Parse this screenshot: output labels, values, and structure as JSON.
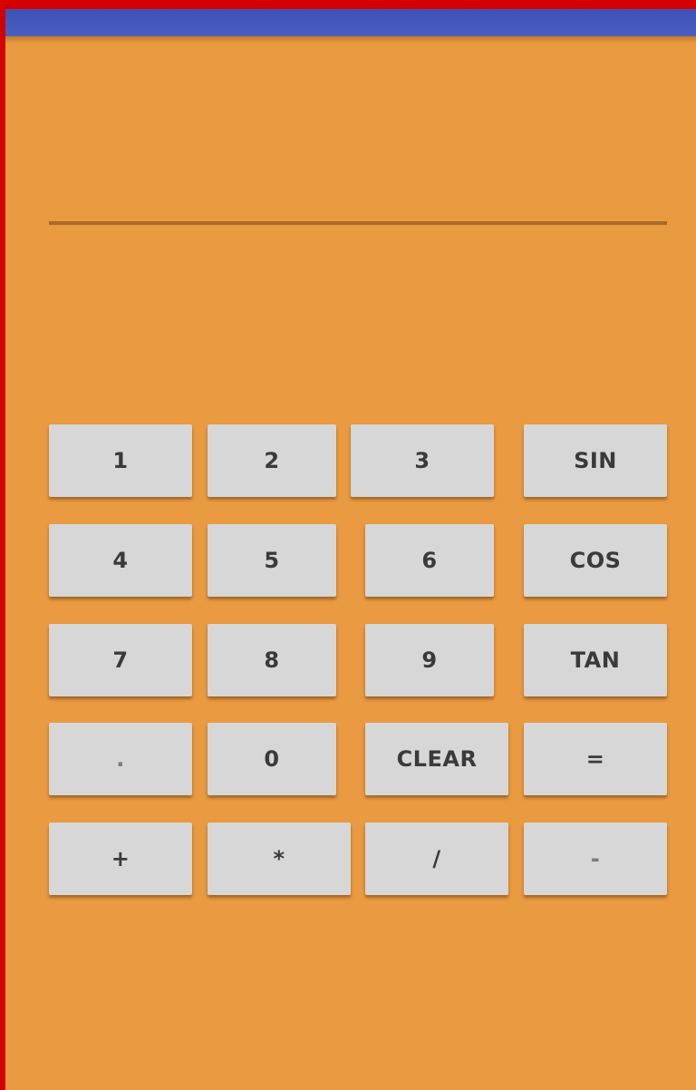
{
  "display": {
    "value": "",
    "placeholder": ""
  },
  "keypad": {
    "k1": "1",
    "k2": "2",
    "k3": "3",
    "sin": "SIN",
    "k4": "4",
    "k5": "5",
    "k6": "6",
    "cos": "COS",
    "k7": "7",
    "k8": "8",
    "k9": "9",
    "tan": "TAN",
    "dot": ".",
    "k0": "0",
    "clear": "CLEAR",
    "equals": "=",
    "plus": "+",
    "multiply": "*",
    "divide": "/",
    "minus": "-"
  },
  "colors": {
    "background": "#ea9a40",
    "status_bar": "#3f51b5",
    "key": "#d6d7d6",
    "underline": "#a96a26",
    "frame_border": "#d40000"
  }
}
